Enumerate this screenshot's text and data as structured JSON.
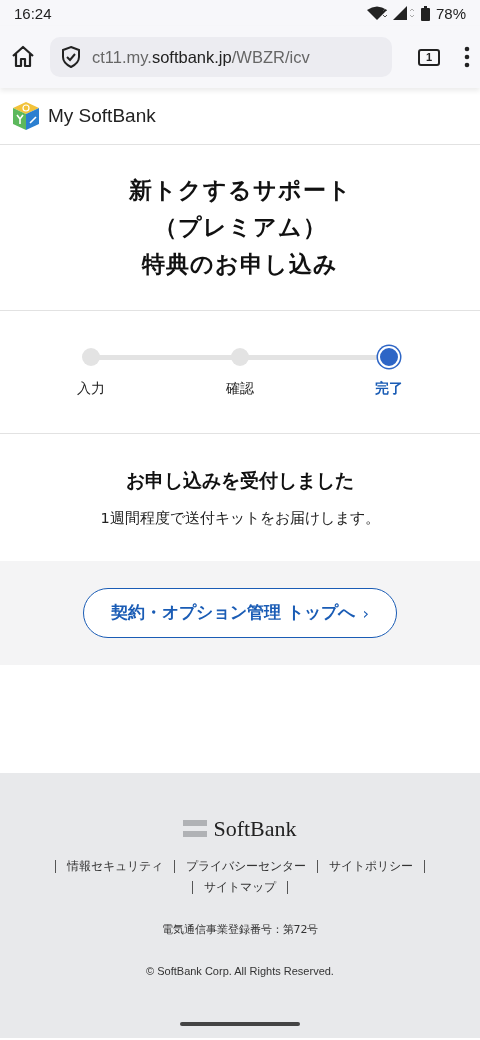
{
  "status_bar": {
    "time": "16:24",
    "battery": "78%"
  },
  "browser": {
    "url_host": "ct11.my.",
    "url_domain": "softbank.jp",
    "url_path": "/WBZR/icv",
    "tab_count": "1"
  },
  "site_header": {
    "brand": "My SoftBank"
  },
  "title_lines": [
    "新トクするサポート",
    "（プレミアム）",
    "特典のお申し込み"
  ],
  "steps": [
    {
      "label": "入力",
      "selected": false
    },
    {
      "label": "確認",
      "selected": false
    },
    {
      "label": "完了",
      "selected": true
    }
  ],
  "message": {
    "heading": "お申し込みを受付しました",
    "body": "1週間程度で送付キットをお届けします。"
  },
  "action_button": {
    "label": "契約・オプション管理 トップへ",
    "chevron": "›"
  },
  "footer": {
    "logo": "SoftBank",
    "links": [
      [
        "情報セキュリティ",
        "プライバシーセンター",
        "サイトポリシー"
      ],
      [
        "サイトマップ"
      ]
    ],
    "registration": "電気通信事業登録番号：第72号",
    "copyright": "© SoftBank Corp. All Rights Reserved."
  }
}
